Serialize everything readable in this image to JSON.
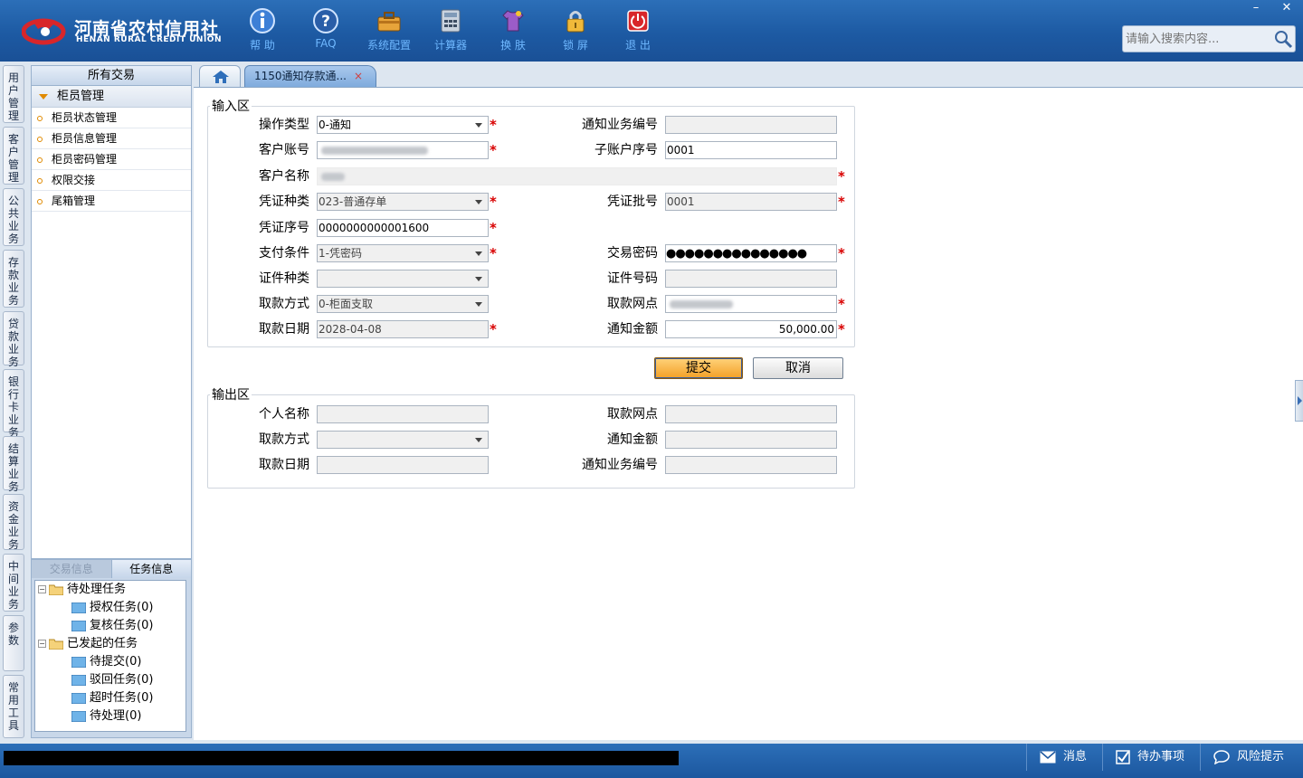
{
  "brand": {
    "name_cn": "河南省农村信用社",
    "name_en": "HENAN RURAL CREDIT UNION"
  },
  "toolbar": [
    {
      "label": "帮 助",
      "icon": "info-icon"
    },
    {
      "label": "FAQ",
      "icon": "help-icon"
    },
    {
      "label": "系统配置",
      "icon": "toolbox-icon"
    },
    {
      "label": "计算器",
      "icon": "calculator-icon"
    },
    {
      "label": "换 肤",
      "icon": "shirt-icon"
    },
    {
      "label": "锁 屏",
      "icon": "lock-icon"
    },
    {
      "label": "退 出",
      "icon": "power-icon"
    }
  ],
  "window": {
    "minimize": "–",
    "close": "✕"
  },
  "search": {
    "placeholder": "请输入搜索内容..."
  },
  "vnav": [
    "用户管理",
    "客户管理",
    "公共业务",
    "存款业务",
    "贷款业务",
    "银行卡业务",
    "结算业务",
    "资金业务",
    "中间业务",
    "参数",
    "常用工具"
  ],
  "sidebar": {
    "header": "所有交易",
    "section": "柜员管理",
    "items": [
      "柜员状态管理",
      "柜员信息管理",
      "柜员密码管理",
      "权限交接",
      "尾箱管理"
    ]
  },
  "bottom_panel": {
    "tabs": [
      "交易信息",
      "任务信息"
    ],
    "tree": {
      "pending": "待处理任务",
      "pending_children": [
        "授权任务(0)",
        "复核任务(0)"
      ],
      "initiated": "已发起的任务",
      "initiated_children": [
        "待提交(0)",
        "驳回任务(0)",
        "超时任务(0)",
        "待处理(0)"
      ]
    }
  },
  "tabs": {
    "active": "1150通知存款通...",
    "close": "×"
  },
  "form": {
    "input_legend": "输入区",
    "output_legend": "输出区",
    "required_mark": "*",
    "fields": {
      "op_type": {
        "label": "操作类型",
        "value": "0-通知"
      },
      "notice_no": {
        "label": "通知业务编号",
        "value": ""
      },
      "account": {
        "label": "客户账号",
        "value": ""
      },
      "sub_account": {
        "label": "子账户序号",
        "value": "0001"
      },
      "cust_name": {
        "label": "客户名称",
        "value": ""
      },
      "voucher_type": {
        "label": "凭证种类",
        "value": "023-普通存单"
      },
      "voucher_batch": {
        "label": "凭证批号",
        "value": "0001"
      },
      "voucher_seq": {
        "label": "凭证序号",
        "value": "0000000000001600"
      },
      "pay_cond": {
        "label": "支付条件",
        "value": "1-凭密码"
      },
      "trans_pwd": {
        "label": "交易密码",
        "value": "●●●●●●●●●●●●●●●"
      },
      "id_type": {
        "label": "证件种类",
        "value": ""
      },
      "id_no": {
        "label": "证件号码",
        "value": ""
      },
      "draw_method": {
        "label": "取款方式",
        "value": "0-柜面支取"
      },
      "draw_branch": {
        "label": "取款网点",
        "value": ""
      },
      "draw_date": {
        "label": "取款日期",
        "value": "2028-04-08"
      },
      "notice_amount": {
        "label": "通知金额",
        "value": "50,000.00"
      }
    },
    "output": {
      "person_name": {
        "label": "个人名称",
        "value": ""
      },
      "draw_branch": {
        "label": "取款网点",
        "value": ""
      },
      "draw_method": {
        "label": "取款方式",
        "value": ""
      },
      "notice_amount": {
        "label": "通知金额",
        "value": ""
      },
      "draw_date": {
        "label": "取款日期",
        "value": ""
      },
      "notice_no": {
        "label": "通知业务编号",
        "value": ""
      }
    },
    "buttons": {
      "submit": "提交",
      "cancel": "取消"
    }
  },
  "statusbar": {
    "messages": "消息",
    "todo": "待办事项",
    "risk": "风险提示"
  },
  "colors": {
    "header_blue": "#1d5aa3",
    "required_red": "#d80000",
    "submit_orange": "#f3a026"
  }
}
